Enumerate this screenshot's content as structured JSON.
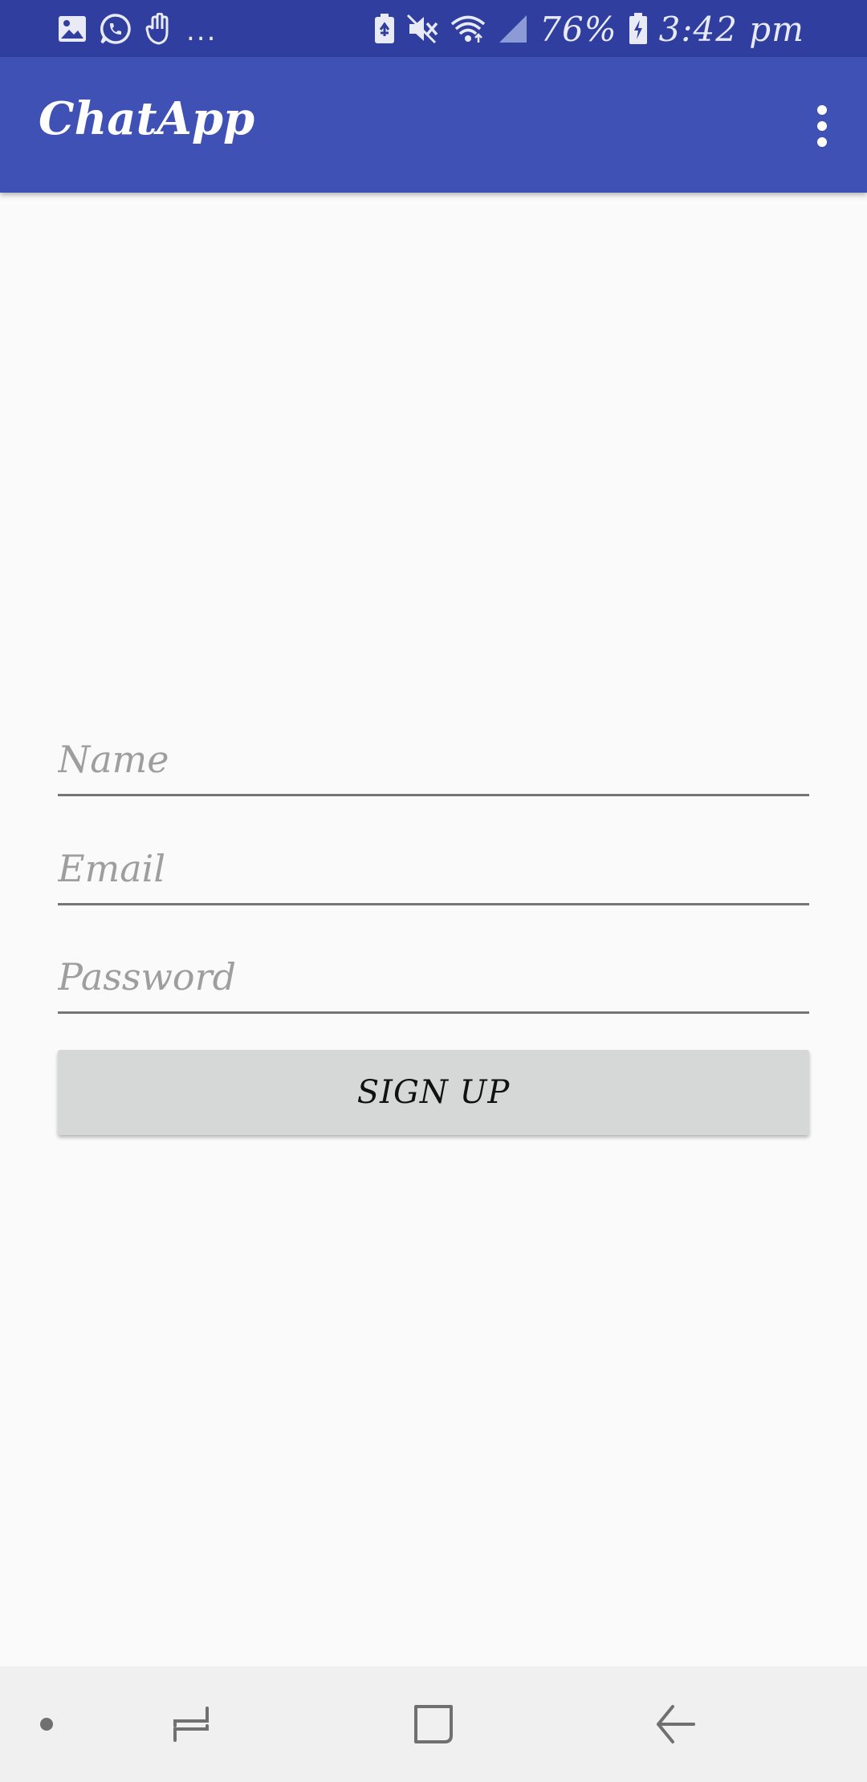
{
  "status_bar": {
    "battery": "76%",
    "time": "3:42 pm",
    "overflow": "...",
    "icons": [
      "gallery-icon",
      "whatsapp-icon",
      "hand-icon",
      "battery-saver-icon",
      "mute-icon",
      "wifi-icon",
      "cell-signal-icon",
      "battery-icon"
    ]
  },
  "app_bar": {
    "title": "ChatApp",
    "menu_icon": "overflow-menu-icon"
  },
  "form": {
    "name_placeholder": "Name",
    "email_placeholder": "Email",
    "password_placeholder": "Password",
    "signup_label": "SIGN UP"
  },
  "nav_bar": {
    "icons": [
      "dot-icon",
      "recents-icon",
      "home-icon",
      "back-icon"
    ]
  },
  "colors": {
    "status_bar": "#303f9f",
    "app_bar": "#3f51b5",
    "background": "#fafafa",
    "button": "#d6d7d7",
    "nav_bar": "#f0f0f0"
  }
}
